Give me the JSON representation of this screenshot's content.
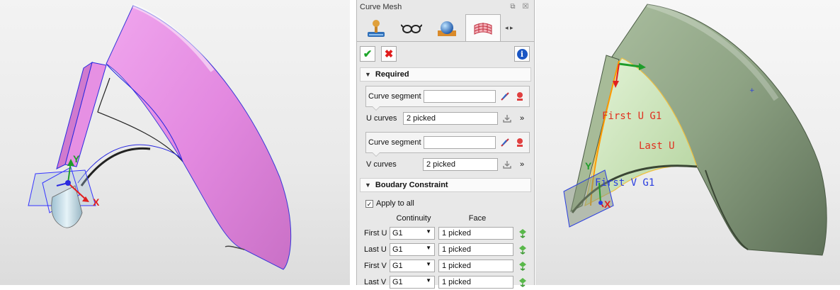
{
  "left_view": {
    "axis_y": "Y",
    "axis_x": "X",
    "colors": {
      "surface": "#e88ae6",
      "edge": "#2a2ae0",
      "frame": "#3535ff",
      "cylinder": "#bcd9e6"
    }
  },
  "panel": {
    "title": "Curve Mesh",
    "title_buttons": {
      "restore": "⧉",
      "close": "☒"
    },
    "tabs": [
      {
        "icon": "joystick-icon",
        "active": false
      },
      {
        "icon": "glasses-icon",
        "active": false
      },
      {
        "icon": "sphere-icon",
        "active": false
      },
      {
        "icon": "mesh-surface-icon",
        "active": true
      }
    ],
    "tab_scroll": "◂ ▸",
    "actions": {
      "ok": "✔",
      "cancel": "✖",
      "info": "i"
    },
    "required": {
      "header": "Required",
      "u_segment_label": "Curve segment",
      "u_segment_value": "",
      "u_curves_label": "U curves",
      "u_curves_value": "2 picked",
      "v_segment_label": "Curve segment",
      "v_segment_value": "",
      "v_curves_label": "V curves",
      "v_curves_value": "2 picked"
    },
    "boundary": {
      "header": "Boudary Constraint",
      "apply_to_all": "Apply to all",
      "apply_checked": "✓",
      "col_continuity": "Continuity",
      "col_face": "Face",
      "rows": [
        {
          "label": "First U",
          "continuity": "G1",
          "face": "1 picked"
        },
        {
          "label": "Last U",
          "continuity": "G1",
          "face": "1 picked"
        },
        {
          "label": "First V",
          "continuity": "G1",
          "face": "1 picked"
        },
        {
          "label": "Last V",
          "continuity": "G1",
          "face": "1 picked"
        }
      ]
    }
  },
  "right_view": {
    "first_u": "First U G1",
    "last_u": "Last U",
    "first_v": "First V G1",
    "axis_y": "Y",
    "axis_x": "X",
    "colors": {
      "surface": "#94a88a",
      "patch": "#cfe6bf",
      "annot_red": "#e03020",
      "annot_blue": "#2a3ee0"
    }
  }
}
